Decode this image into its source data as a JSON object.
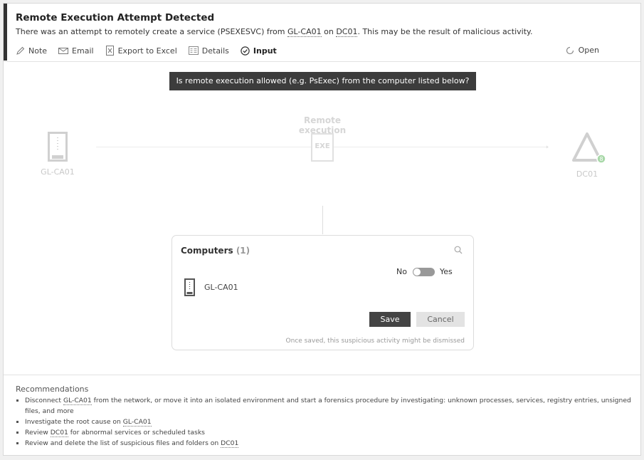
{
  "alert": {
    "title": "Remote Execution Attempt Detected",
    "description": {
      "prefix": "There was an attempt to remotely create a service (PSEXESVC) from ",
      "source": "GL-CA01",
      "mid": " on ",
      "target": "DC01",
      "suffix": ". This may be the result of malicious activity."
    }
  },
  "toolbar": {
    "note": "Note",
    "email": "Email",
    "export": "Export to Excel",
    "details": "Details",
    "input": "Input",
    "status": "Open"
  },
  "question": "Is remote execution allowed (e.g. PsExec) from the computer listed below?",
  "flow": {
    "source_label": "GL-CA01",
    "action_label": "Remote execution",
    "action_icon_text": "EXE",
    "target_label": "DC01"
  },
  "panel": {
    "title": "Computers",
    "count": "(1)",
    "toggle_no": "No",
    "toggle_yes": "Yes",
    "toggle_value": "No",
    "computer": "GL-CA01",
    "save": "Save",
    "cancel": "Cancel",
    "note": "Once saved, this suspicious activity might be dismissed"
  },
  "recommendations": {
    "title": "Recommendations",
    "items": [
      {
        "a": "Disconnect ",
        "link": "GL-CA01",
        "b": " from the network, or move it into an isolated environment and start a forensics procedure by investigating: unknown processes, services, registry entries, unsigned files, and more"
      },
      {
        "a": "Investigate the root cause on ",
        "link": "GL-CA01",
        "b": ""
      },
      {
        "a": "Review ",
        "link": "DC01",
        "b": " for abnormal services or scheduled tasks"
      },
      {
        "a": "Review and delete the list of suspicious files and folders on ",
        "link": "DC01",
        "b": ""
      }
    ]
  },
  "colors": {
    "accent": "#333333",
    "status_badge": "#5cb85c",
    "faded": "#cccccc"
  }
}
